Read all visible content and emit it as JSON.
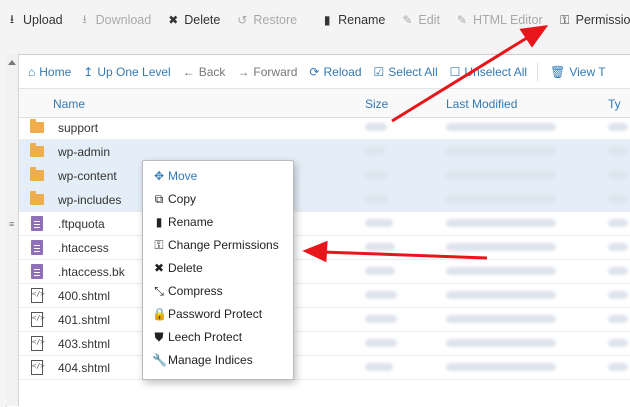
{
  "toolbar": {
    "items": [
      {
        "label": "Upload",
        "icon": "upload-icon",
        "glyph": "⭳",
        "enabled": true
      },
      {
        "label": "Download",
        "icon": "download-icon",
        "glyph": "⭳",
        "enabled": false
      },
      {
        "label": "Delete",
        "icon": "delete-icon",
        "glyph": "✖",
        "enabled": true
      },
      {
        "label": "Restore",
        "icon": "restore-icon",
        "glyph": "↺",
        "enabled": false
      },
      {
        "label": "Rename",
        "icon": "file-icon",
        "glyph": "▮",
        "enabled": true
      },
      {
        "label": "Edit",
        "icon": "pencil-icon",
        "glyph": "✎",
        "enabled": false
      },
      {
        "label": "HTML Editor",
        "icon": "edit-icon",
        "glyph": "✎",
        "enabled": false
      },
      {
        "label": "Permissions",
        "icon": "key-icon",
        "glyph": "⚿",
        "enabled": true
      }
    ]
  },
  "nav": {
    "home": "Home",
    "up_one_level": "Up One Level",
    "back": "Back",
    "forward": "Forward",
    "reload": "Reload",
    "select_all": "Select All",
    "unselect_all": "Unselect All",
    "view_trash": "View T"
  },
  "columns": {
    "name": "Name",
    "size": "Size",
    "last_modified": "Last Modified",
    "type": "Ty"
  },
  "files": [
    {
      "name": "support",
      "type": "folder",
      "selected": false
    },
    {
      "name": "wp-admin",
      "type": "folder",
      "selected": true
    },
    {
      "name": "wp-content",
      "type": "folder",
      "selected": true
    },
    {
      "name": "wp-includes",
      "type": "folder",
      "selected": true
    },
    {
      "name": ".ftpquota",
      "type": "text",
      "selected": false
    },
    {
      "name": ".htaccess",
      "type": "text",
      "selected": false
    },
    {
      "name": ".htaccess.bk",
      "type": "text",
      "selected": false
    },
    {
      "name": "400.shtml",
      "type": "html",
      "selected": false
    },
    {
      "name": "401.shtml",
      "type": "html",
      "selected": false
    },
    {
      "name": "403.shtml",
      "type": "html",
      "selected": false
    },
    {
      "name": "404.shtml",
      "type": "html",
      "selected": false
    }
  ],
  "context_menu": {
    "items": [
      {
        "label": "Move",
        "icon": "move-icon",
        "glyph": "✥"
      },
      {
        "label": "Copy",
        "icon": "copy-icon",
        "glyph": "⧉"
      },
      {
        "label": "Rename",
        "icon": "file-icon",
        "glyph": "▮"
      },
      {
        "label": "Change Permissions",
        "icon": "key-icon",
        "glyph": "⚿"
      },
      {
        "label": "Delete",
        "icon": "delete-icon",
        "glyph": "✖"
      },
      {
        "label": "Compress",
        "icon": "compress-icon",
        "glyph": "⤡"
      },
      {
        "label": "Password Protect",
        "icon": "lock-icon",
        "glyph": "🔒"
      },
      {
        "label": "Leech Protect",
        "icon": "shield-icon",
        "glyph": "⛊"
      },
      {
        "label": "Manage Indices",
        "icon": "wrench-icon",
        "glyph": "🔧"
      }
    ]
  },
  "colors": {
    "link": "#337ab7",
    "selected_row": "#e4eef8",
    "folder": "#f0ad4e",
    "text_file": "#8e6fb8",
    "annotation_arrow": "#e8161b"
  }
}
